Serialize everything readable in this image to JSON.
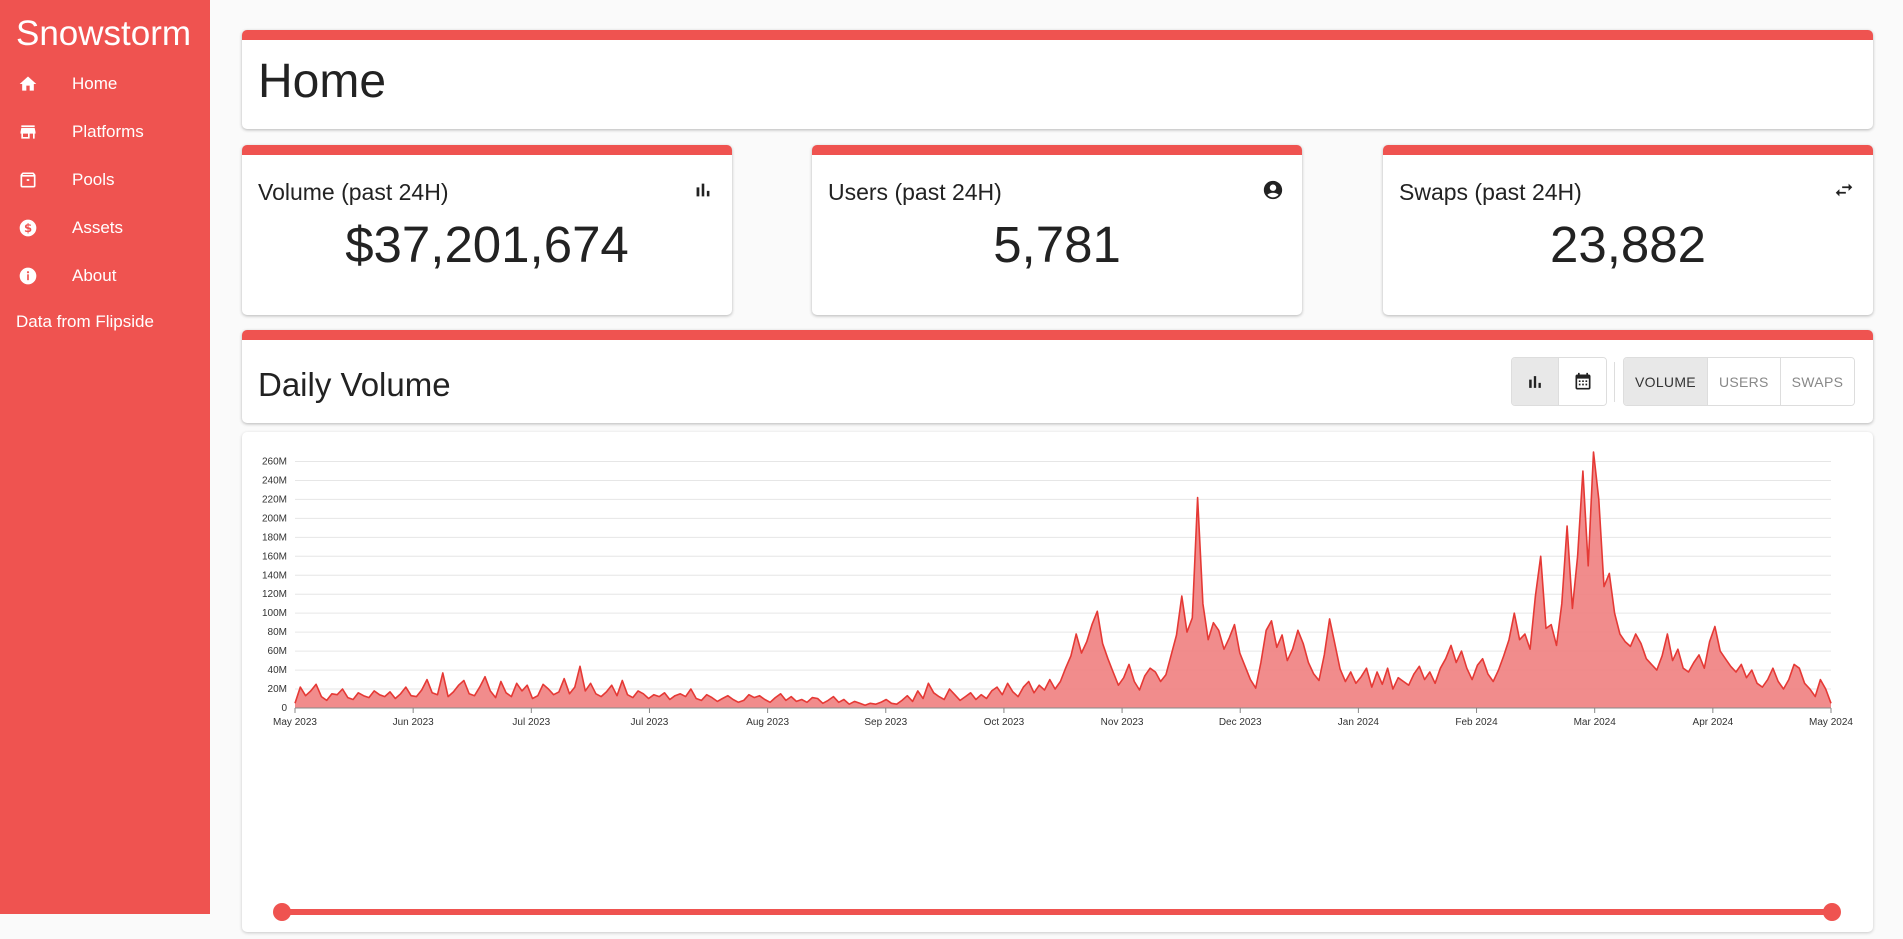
{
  "app": {
    "title": "Snowstorm"
  },
  "sidebar": {
    "items": [
      {
        "label": "Home",
        "icon": "home-icon"
      },
      {
        "label": "Platforms",
        "icon": "store-icon"
      },
      {
        "label": "Pools",
        "icon": "archive-icon"
      },
      {
        "label": "Assets",
        "icon": "dollar-icon"
      },
      {
        "label": "About",
        "icon": "info-icon"
      }
    ],
    "data_source": "Data from Flipside"
  },
  "page": {
    "title": "Home"
  },
  "stats": {
    "volume": {
      "title": "Volume (past 24H)",
      "value": "$37,201,674",
      "icon": "bar-chart-icon"
    },
    "users": {
      "title": "Users (past 24H)",
      "value": "5,781",
      "icon": "account-circle-icon"
    },
    "swaps": {
      "title": "Swaps (past 24H)",
      "value": "23,882",
      "icon": "swap-arrows-icon"
    }
  },
  "chart_section": {
    "title": "Daily Volume",
    "view_buttons": [
      {
        "icon": "bar-chart-icon",
        "active": true
      },
      {
        "icon": "calendar-icon",
        "active": false
      }
    ],
    "metric_buttons": [
      {
        "label": "VOLUME",
        "active": true
      },
      {
        "label": "USERS",
        "active": false
      },
      {
        "label": "SWAPS",
        "active": false
      }
    ]
  },
  "colors": {
    "accent": "#ef5350",
    "line": "#e53935",
    "fill": "#f08080"
  },
  "chart_data": {
    "type": "area",
    "title": "",
    "xlabel": "",
    "ylabel": "",
    "ylim": [
      0,
      270
    ],
    "y_unit": "M",
    "yticks": [
      "0",
      "20M",
      "40M",
      "60M",
      "80M",
      "100M",
      "120M",
      "140M",
      "160M",
      "180M",
      "200M",
      "220M",
      "240M",
      "260M"
    ],
    "xticks": [
      "May 2023",
      "Jun 2023",
      "Jul 2023",
      "Jul 2023",
      "Aug 2023",
      "Sep 2023",
      "Oct 2023",
      "Nov 2023",
      "Dec 2023",
      "Jan 2024",
      "Feb 2024",
      "Mar 2024",
      "Apr 2024",
      "May 2024"
    ],
    "x_start": "2023-05-01",
    "x_end": "2024-05-01",
    "grid": true,
    "legend": "none",
    "series": [
      {
        "values": [
          5,
          22,
          13,
          18,
          25,
          12,
          8,
          15,
          14,
          20,
          11,
          9,
          16,
          13,
          11,
          18,
          14,
          12,
          17,
          10,
          15,
          22,
          13,
          12,
          19,
          30,
          16,
          14,
          37,
          12,
          17,
          24,
          29,
          15,
          13,
          22,
          33,
          18,
          11,
          28,
          16,
          12,
          26,
          18,
          24,
          10,
          13,
          25,
          20,
          14,
          17,
          31,
          15,
          22,
          44,
          18,
          26,
          15,
          12,
          17,
          24,
          13,
          29,
          14,
          11,
          18,
          15,
          10,
          14,
          12,
          16,
          9,
          13,
          15,
          12,
          20,
          10,
          8,
          14,
          11,
          7,
          10,
          13,
          9,
          6,
          8,
          14,
          11,
          13,
          9,
          6,
          11,
          15,
          8,
          12,
          7,
          9,
          6,
          11,
          10,
          5,
          8,
          12,
          6,
          9,
          4,
          7,
          5,
          3,
          5,
          4,
          6,
          9,
          5,
          4,
          8,
          13,
          7,
          18,
          10,
          26,
          16,
          12,
          9,
          20,
          14,
          8,
          12,
          16,
          9,
          14,
          10,
          18,
          22,
          14,
          26,
          17,
          12,
          22,
          28,
          16,
          24,
          19,
          30,
          20,
          28,
          42,
          55,
          78,
          58,
          70,
          88,
          102,
          68,
          52,
          38,
          24,
          32,
          46,
          28,
          19,
          34,
          42,
          38,
          28,
          35,
          56,
          77,
          118,
          80,
          95,
          222,
          110,
          72,
          90,
          82,
          62,
          74,
          88,
          58,
          44,
          30,
          21,
          48,
          82,
          92,
          64,
          77,
          50,
          62,
          82,
          68,
          48,
          36,
          29,
          56,
          94,
          68,
          41,
          28,
          38,
          26,
          33,
          42,
          22,
          38,
          25,
          42,
          20,
          32,
          28,
          24,
          36,
          44,
          30,
          38,
          26,
          42,
          52,
          66,
          48,
          60,
          42,
          30,
          45,
          52,
          36,
          28,
          40,
          55,
          72,
          100,
          72,
          78,
          62,
          118,
          160,
          84,
          88,
          66,
          110,
          192,
          105,
          160,
          250,
          150,
          270,
          220,
          128,
          142,
          100,
          78,
          70,
          65,
          78,
          68,
          52,
          46,
          40,
          55,
          78,
          50,
          62,
          42,
          38,
          48,
          56,
          42,
          70,
          86,
          60,
          52,
          44,
          38,
          46,
          32,
          40,
          26,
          22,
          30,
          42,
          28,
          20,
          30,
          46,
          42,
          26,
          20,
          12,
          30,
          20,
          5
        ]
      }
    ]
  }
}
